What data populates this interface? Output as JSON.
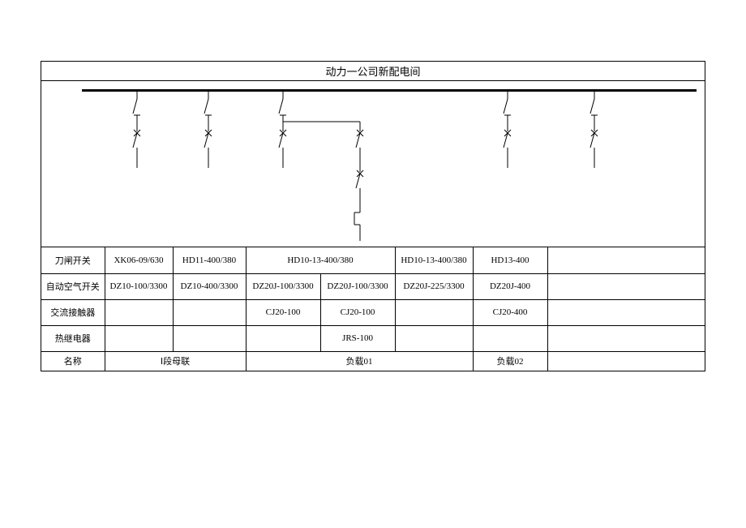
{
  "title": "动力一公司新配电间",
  "rows": {
    "knife_label": "刀闸开关",
    "air_label": "自动空气开关",
    "contactor_label": "交流接触器",
    "thermal_label": "热继电器",
    "name_label": "名称"
  },
  "cols": {
    "c1": {
      "knife": "XK06-09/630",
      "air": "DZ10-100/3300",
      "contactor": "",
      "thermal": ""
    },
    "c2": {
      "knife": "HD11-400/380",
      "air": "DZ10-400/3300",
      "contactor": "",
      "thermal": ""
    },
    "c3": {
      "knife_merged": "HD10-13-400/380",
      "air": "DZ20J-100/3300",
      "contactor": "CJ20-100",
      "thermal": ""
    },
    "c4": {
      "air": "DZ20J-100/3300",
      "contactor": "CJ20-100",
      "thermal": "JRS-100"
    },
    "c5": {
      "knife": "HD10-13-400/380",
      "air": "DZ20J-225/3300",
      "contactor": "",
      "thermal": ""
    },
    "c6": {
      "knife": "HD13-400",
      "air": "DZ20J-400",
      "contactor": "CJ20-400",
      "thermal": ""
    }
  },
  "names": {
    "n1": "Ⅰ段母联",
    "n2": "负载01",
    "n3": "负载02"
  }
}
